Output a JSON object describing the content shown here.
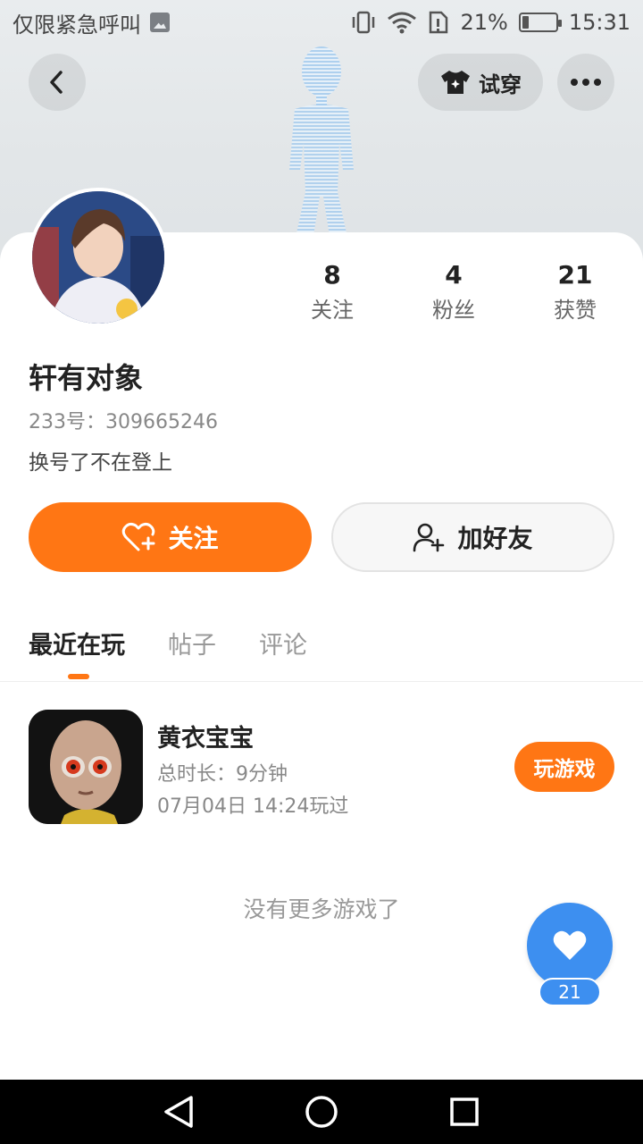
{
  "status_bar": {
    "left_text": "仅限紧急呼叫",
    "battery_percent": "21%",
    "time": "15:31",
    "battery_level": 0.21
  },
  "header": {
    "try_on_label": "试穿"
  },
  "profile": {
    "stats": [
      {
        "num": "8",
        "label": "关注"
      },
      {
        "num": "4",
        "label": "粉丝"
      },
      {
        "num": "21",
        "label": "获赞"
      }
    ],
    "username": "轩有对象",
    "uid": "233号：309665246",
    "bio": "换号了不在登上",
    "follow_label": "关注",
    "add_friend_label": "加好友"
  },
  "tabs": [
    {
      "label": "最近在玩",
      "active": true
    },
    {
      "label": "帖子",
      "active": false
    },
    {
      "label": "评论",
      "active": false
    }
  ],
  "games": [
    {
      "title": "黄衣宝宝",
      "duration": "总时长：9分钟",
      "last_played": "07月04日 14:24玩过",
      "play_label": "玩游戏"
    }
  ],
  "no_more_text": "没有更多游戏了",
  "like_fab": {
    "count": "21"
  },
  "colors": {
    "accent_orange": "#ff7614",
    "like_blue": "#3d8ff0"
  },
  "icons": {
    "back": "chevron-left-icon",
    "try_on": "tshirt-icon",
    "more": "more-dots-icon",
    "follow": "heart-plus-icon",
    "add_friend": "person-plus-icon",
    "like": "heart-icon"
  }
}
